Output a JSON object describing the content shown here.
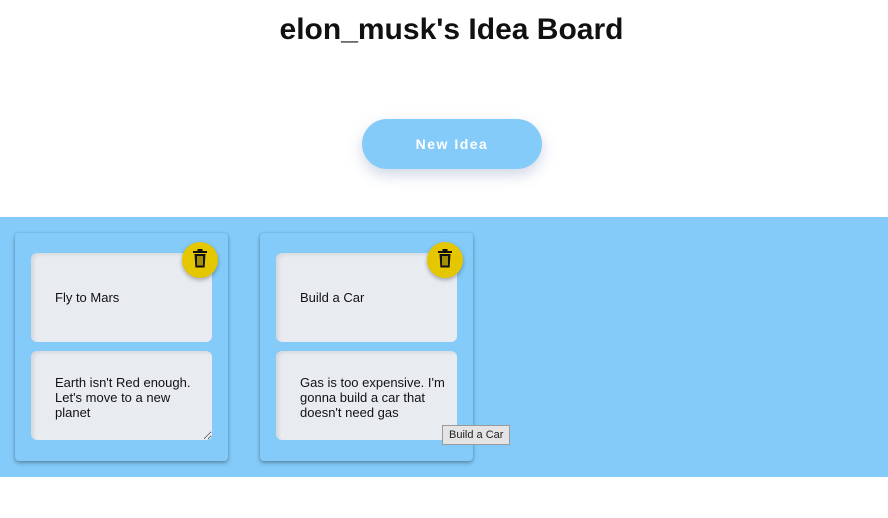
{
  "page": {
    "title": "elon_musk's Idea Board"
  },
  "toolbar": {
    "new_idea_label": "New Idea"
  },
  "colors": {
    "board_background": "#84cbf9",
    "button_background": "#84cbf9",
    "delete_button": "#e4c700",
    "field_background": "#e8ecf1"
  },
  "ideas": [
    {
      "title": "Fly to Mars",
      "body": "Earth isn't Red enough.  Let's move to a new planet",
      "delete_icon": "trash-icon"
    },
    {
      "title": "Build a Car",
      "body": "Gas is too expensive. I'm gonna build a car that doesn't need gas",
      "delete_icon": "trash-icon"
    }
  ],
  "tooltip": {
    "text": "Build a Car"
  }
}
